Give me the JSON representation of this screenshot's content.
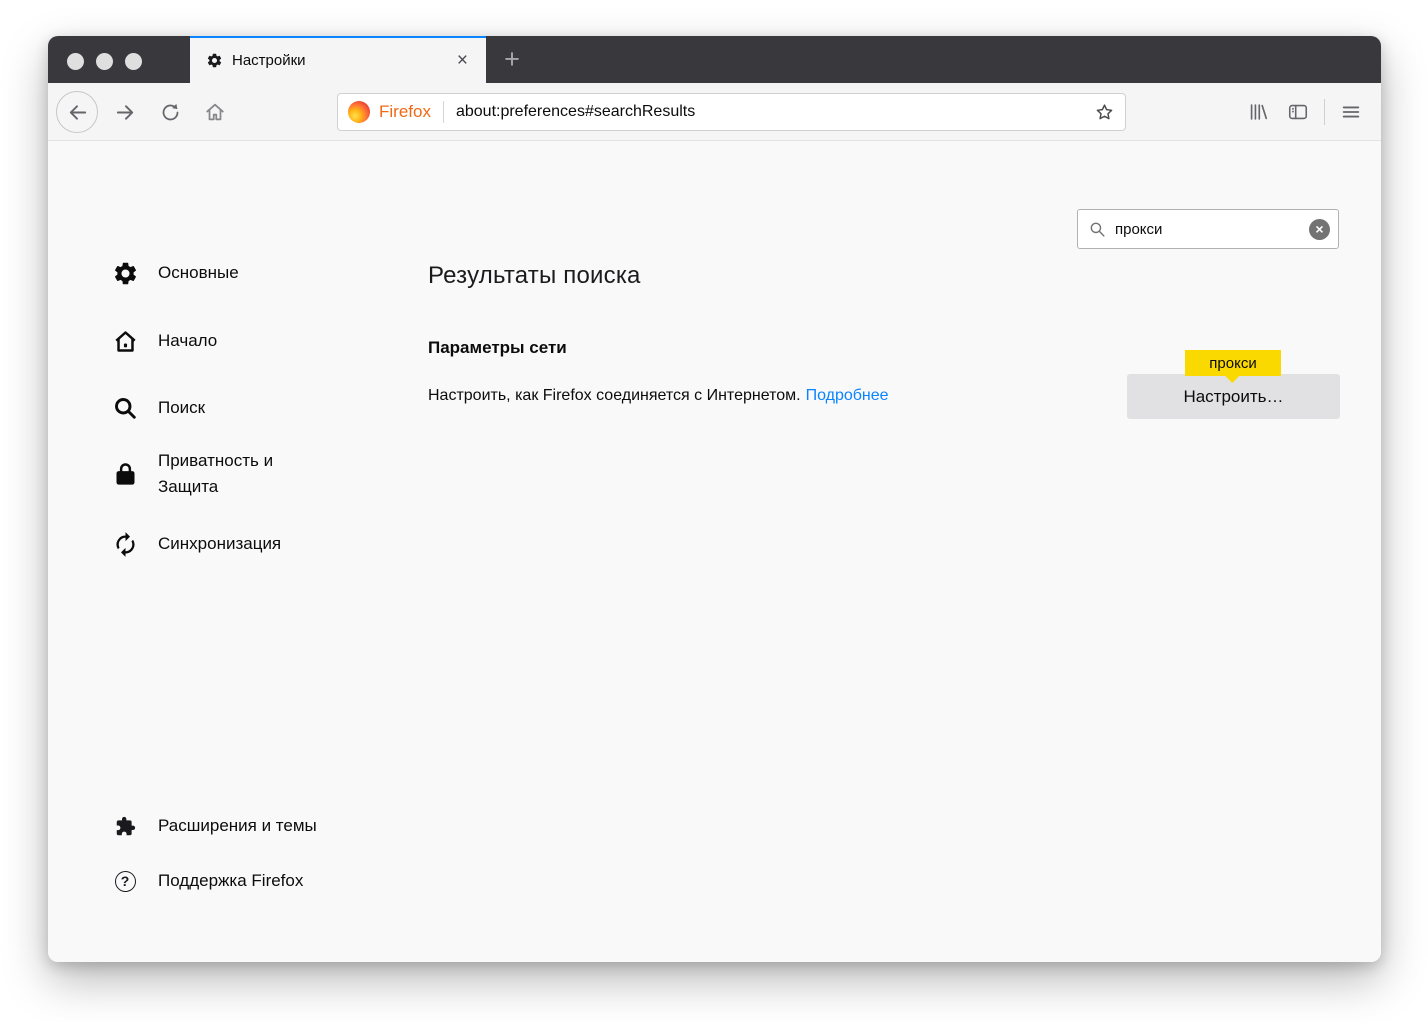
{
  "chrome": {
    "tab_title": "Настройки",
    "brand": "Firefox",
    "url": "about:preferences#searchResults"
  },
  "glyphs": {
    "close": "×",
    "plus": "+",
    "help": "?",
    "clear": "×"
  },
  "search": {
    "value": "прокси"
  },
  "sidebar": {
    "items": [
      {
        "label": "Основные"
      },
      {
        "label": "Начало"
      },
      {
        "label": "Поиск"
      },
      {
        "label": "Приватность и Защита"
      },
      {
        "label": "Синхронизация"
      }
    ],
    "footer": [
      {
        "label": "Расширения и темы"
      },
      {
        "label": "Поддержка Firefox"
      }
    ]
  },
  "main": {
    "title": "Результаты поиска",
    "section": {
      "title": "Параметры сети",
      "description": "Настроить, как Firefox соединяется с Интернетом.",
      "link_label": "Подробнее",
      "button_label": "Настроить…",
      "highlight_label": "прокси"
    }
  },
  "colors": {
    "accent_blue": "#0a84ff",
    "link_blue": "#0a84ff",
    "highlight_yellow": "#f9d900",
    "titlebar_dark": "#38383d",
    "brand_orange": "#f06a15"
  }
}
